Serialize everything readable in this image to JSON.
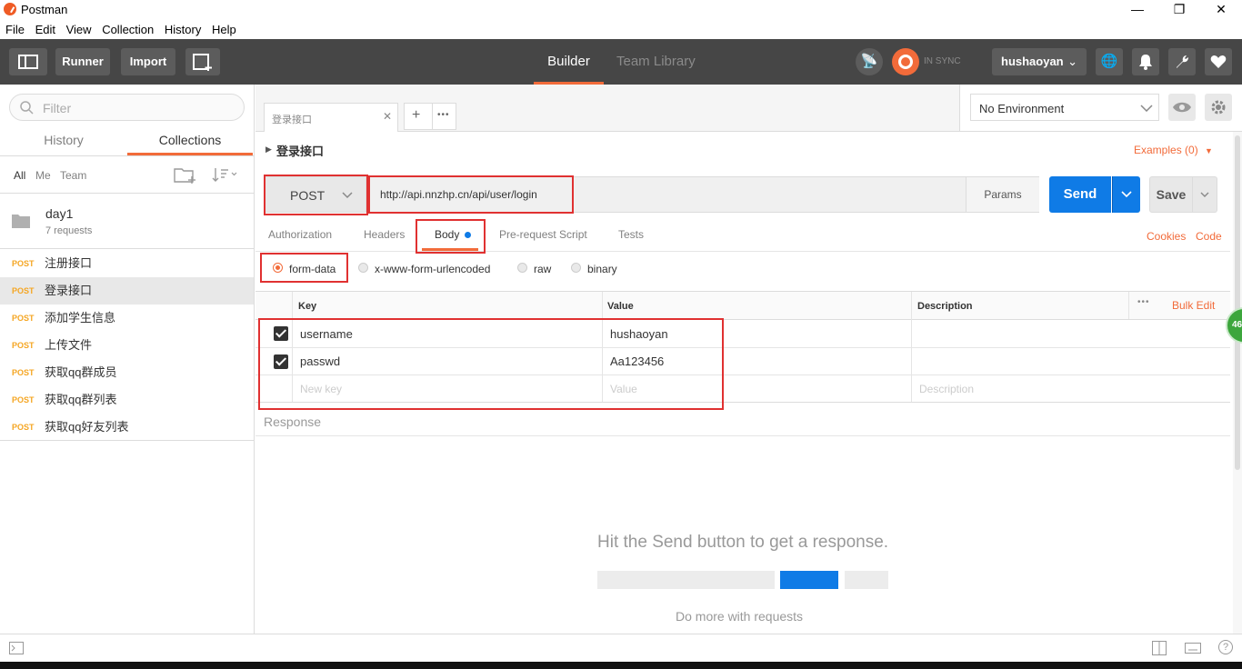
{
  "window": {
    "title": "Postman",
    "minimize": "—",
    "restore": "❐",
    "close": "✕"
  },
  "menu": [
    "File",
    "Edit",
    "View",
    "Collection",
    "History",
    "Help"
  ],
  "header": {
    "runner": "Runner",
    "import": "Import",
    "tabs": {
      "builder": "Builder",
      "team_library": "Team Library"
    },
    "sync_status": "IN SYNC",
    "user": "hushaoyan",
    "accent": "#f26b3a"
  },
  "sidebar": {
    "filter_placeholder": "Filter",
    "tabs": {
      "history": "History",
      "collections": "Collections"
    },
    "scope": {
      "all": "All",
      "me": "Me",
      "team": "Team"
    },
    "collection": {
      "name": "day1",
      "count": "7 requests"
    },
    "requests": [
      {
        "method": "POST",
        "name": "注册接口"
      },
      {
        "method": "POST",
        "name": "登录接口"
      },
      {
        "method": "POST",
        "name": "添加学生信息"
      },
      {
        "method": "POST",
        "name": "上传文件"
      },
      {
        "method": "POST",
        "name": "获取qq群成员"
      },
      {
        "method": "POST",
        "name": "获取qq群列表"
      },
      {
        "method": "POST",
        "name": "获取qq好友列表"
      }
    ]
  },
  "request_tab": {
    "label": "登录接口",
    "close": "✕",
    "add": "+",
    "more": "•••"
  },
  "environment": {
    "selected": "No Environment"
  },
  "request": {
    "title": "登录接口",
    "examples": "Examples (0)",
    "method": "POST",
    "url": "http://api.nnzhp.cn/api/user/login",
    "params": "Params",
    "send": "Send",
    "save": "Save",
    "tabs": [
      "Authorization",
      "Headers",
      "Body",
      "Pre-request Script",
      "Tests"
    ],
    "cookies": "Cookies",
    "code": "Code"
  },
  "body": {
    "modes": [
      "form-data",
      "x-www-form-urlencoded",
      "raw",
      "binary"
    ],
    "columns": {
      "key": "Key",
      "value": "Value",
      "description": "Description"
    },
    "bulk_edit": "Bulk Edit",
    "rows": [
      {
        "key": "username",
        "value": "hushaoyan"
      },
      {
        "key": "passwd",
        "value": "Aa123456"
      }
    ],
    "new_key": "New key",
    "new_value": "Value",
    "new_description": "Description"
  },
  "response": {
    "label": "Response",
    "hint": "Hit the Send button to get a response.",
    "more": "Do more with requests"
  },
  "badge": "46"
}
